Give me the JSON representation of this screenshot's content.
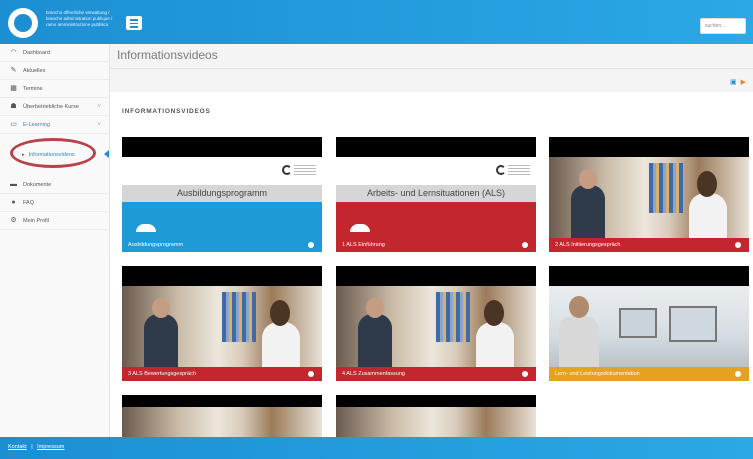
{
  "header": {
    "logo_text": "brancho öffentliche verwaltung / branche administration publique / ramo amministrazione pubblica",
    "search_placeholder": "suchen..."
  },
  "sidebar": {
    "items": [
      {
        "label": "Dashboard",
        "icon": "dashboard-icon"
      },
      {
        "label": "Aktuelles",
        "icon": "pin-icon"
      },
      {
        "label": "Termine",
        "icon": "calendar-icon"
      },
      {
        "label": "Überbetriebliche Kurse",
        "icon": "users-icon"
      },
      {
        "label": "E-Learning",
        "icon": "monitor-icon"
      },
      {
        "label": "Informationsvideos",
        "icon": "caret-right-icon"
      },
      {
        "label": "Dokumente",
        "icon": "folder-icon"
      },
      {
        "label": "FAQ",
        "icon": "pin-icon"
      },
      {
        "label": "Mein Profil",
        "icon": "gear-icon"
      }
    ]
  },
  "main": {
    "page_title": "Informationsvideos",
    "section_title": "INFORMATIONSVIDEOS",
    "cards": [
      {
        "title": "Ausbildungsprogramm",
        "color": "#1e9ad6",
        "slide_text": "Ausbildungsprogramm"
      },
      {
        "title": "1 ALS Einführung",
        "color": "#c4262e",
        "slide_text": "Arbeits- und Lernsituationen (ALS)"
      },
      {
        "title": "2 ALS Initiierungsgespräch",
        "color": "#c4262e"
      },
      {
        "title": "3 ALS Bewertungsgespräch",
        "color": "#c4262e"
      },
      {
        "title": "4 ALS Zusammenfassung",
        "color": "#c4262e"
      },
      {
        "title": "Lern- und Leistungsdokumentation",
        "color": "#e3a321"
      }
    ]
  },
  "footer": {
    "kontakt": "Kontakt",
    "separator": "|",
    "impressum": "Impressum"
  }
}
